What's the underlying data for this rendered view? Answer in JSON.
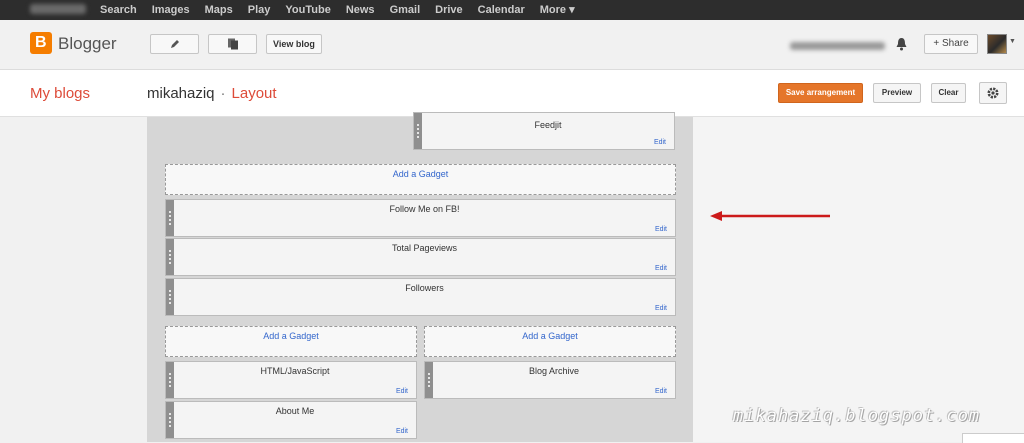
{
  "google_bar": {
    "links": [
      "Search",
      "Images",
      "Maps",
      "Play",
      "YouTube",
      "News",
      "Gmail",
      "Drive",
      "Calendar",
      "More ▾"
    ]
  },
  "header": {
    "logo_text": "Blogger",
    "view_blog_label": "View blog",
    "share_label": "+ Share"
  },
  "subheader": {
    "my_blogs_label": "My blogs",
    "blog_name": "mikahaziq",
    "separator": "·",
    "page_label": "Layout",
    "save_label": "Save arrangement",
    "preview_label": "Preview",
    "clear_label": "Clear"
  },
  "layout": {
    "add_gadget_label": "Add a Gadget",
    "edit_label": "Edit",
    "gadgets": {
      "feedjit": "Feedjit",
      "follow_fb": "Follow Me on FB!",
      "pageviews": "Total Pageviews",
      "followers": "Followers",
      "html_js": "HTML/JavaScript",
      "archive": "Blog Archive",
      "about": "About Me"
    }
  },
  "watermark": "mikahaziq.blogspot.com",
  "colors": {
    "accent": "#dd4b39",
    "save": "#e5762a",
    "link": "#3366cc",
    "arrow": "#cc1a1a"
  }
}
